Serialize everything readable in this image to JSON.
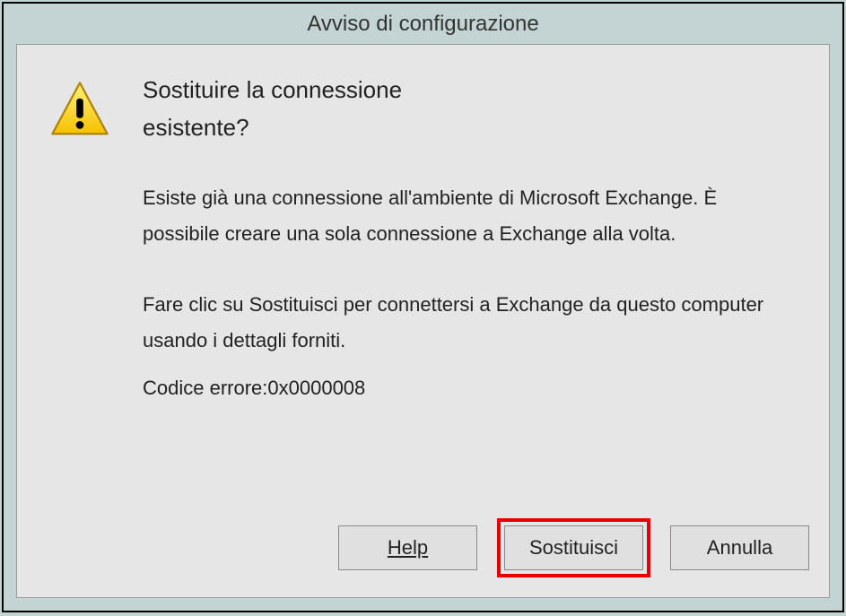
{
  "title": "Avviso di configurazione",
  "heading_line1": "Sostituire la connessione",
  "heading_line2": "esistente?",
  "body_paragraph1": "Esiste già una connessione all'ambiente di Microsoft Exchange. È possibile creare una sola connessione a Exchange alla volta.",
  "body_paragraph2": "Fare clic su Sostituisci per connettersi a Exchange da questo computer usando i dettagli forniti.",
  "error_label": "Codice errore:",
  "error_code": "0x0000008",
  "buttons": {
    "help": "Help",
    "replace": "Sostituisci",
    "cancel": "Annulla"
  }
}
